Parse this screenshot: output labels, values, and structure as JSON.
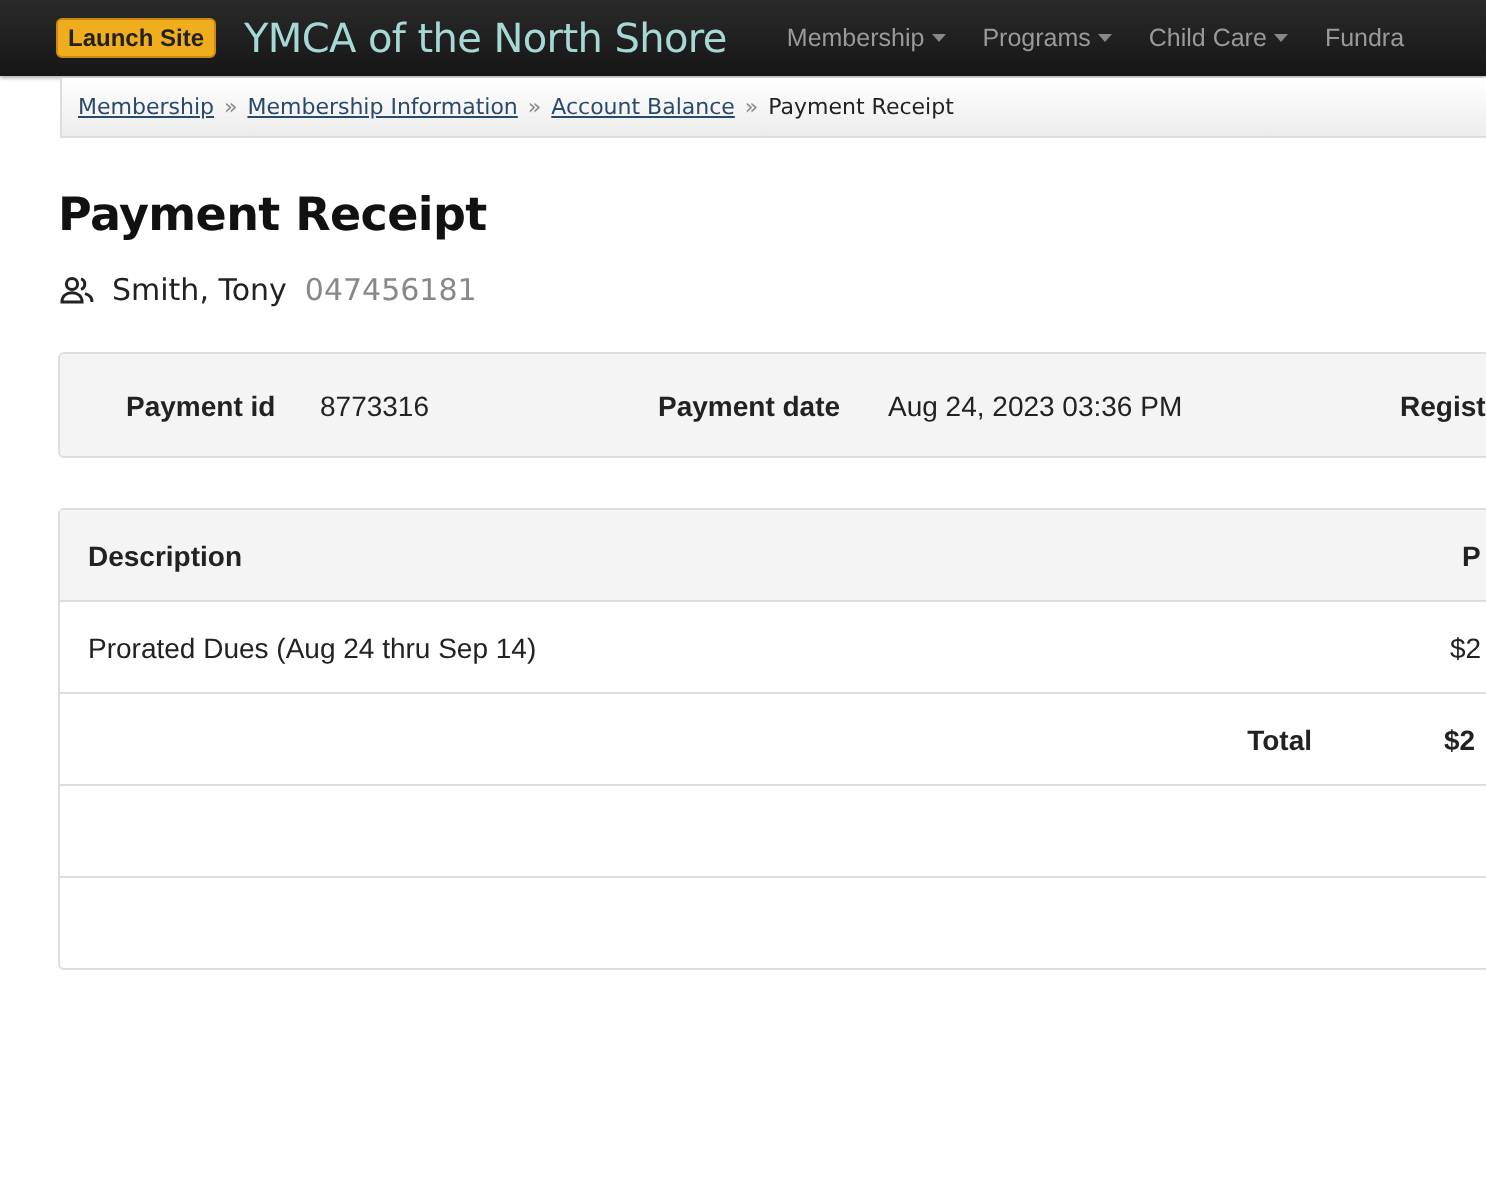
{
  "header": {
    "launch_button": "Launch Site",
    "site_title": "YMCA of the North Shore",
    "nav": [
      {
        "label": "Membership",
        "dropdown": true
      },
      {
        "label": "Programs",
        "dropdown": true
      },
      {
        "label": "Child Care",
        "dropdown": true
      },
      {
        "label": "Fundra",
        "dropdown": false
      }
    ]
  },
  "breadcrumb": [
    {
      "label": "Membership",
      "link": true
    },
    {
      "label": "Membership Information",
      "link": true
    },
    {
      "label": "Account Balance",
      "link": true
    },
    {
      "label": "Payment Receipt",
      "link": false
    }
  ],
  "breadcrumb_separator": "»",
  "title": "Payment Receipt",
  "member": {
    "name": "Smith, Tony",
    "id": "047456181"
  },
  "payment_info": [
    {
      "label": "Payment id",
      "value": "8773316"
    },
    {
      "label": "Payment date",
      "value": "Aug 24, 2023 03:36 PM"
    },
    {
      "label": "Regist"
    }
  ],
  "table": {
    "columns": [
      "Description",
      "P"
    ],
    "rows": [
      {
        "description": "Prorated Dues (Aug 24 thru Sep 14)",
        "amount": "$2"
      }
    ],
    "total": {
      "label": "Total",
      "amount": "$2"
    }
  }
}
